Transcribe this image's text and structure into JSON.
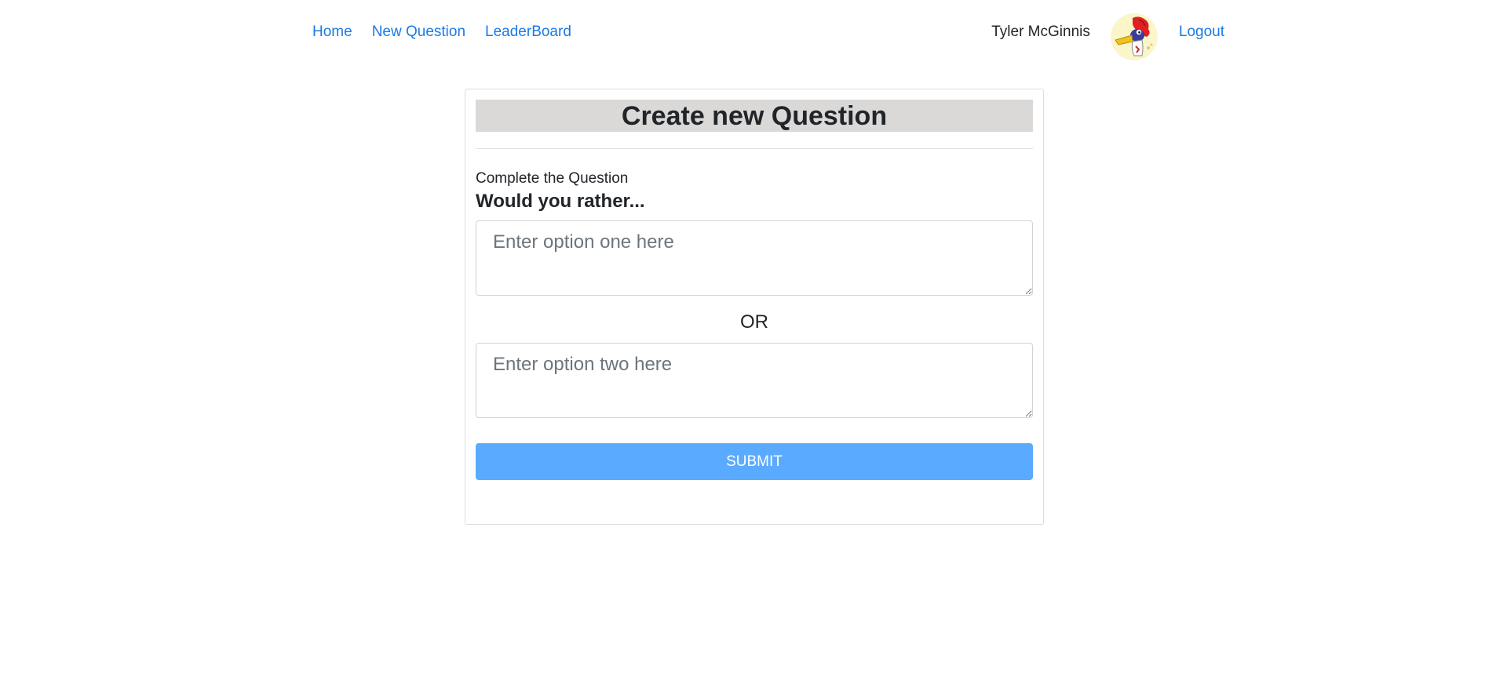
{
  "nav": {
    "home_label": "Home",
    "new_question_label": "New Question",
    "leaderboard_label": "LeaderBoard",
    "user_name": "Tyler McGinnis",
    "avatar_icon": "woodpecker-avatar-icon",
    "logout_label": "Logout",
    "link_color": "#1a7ae6"
  },
  "card": {
    "title": "Create new Question",
    "instruction": "Complete the Question",
    "prompt": "Would you rather...",
    "option_one_placeholder": "Enter option one here",
    "option_one_value": "",
    "or_label": "OR",
    "option_two_placeholder": "Enter option two here",
    "option_two_value": "",
    "submit_label": "SUBMIT",
    "title_bg_color": "#dad9d8",
    "submit_color": "#5aabff"
  }
}
